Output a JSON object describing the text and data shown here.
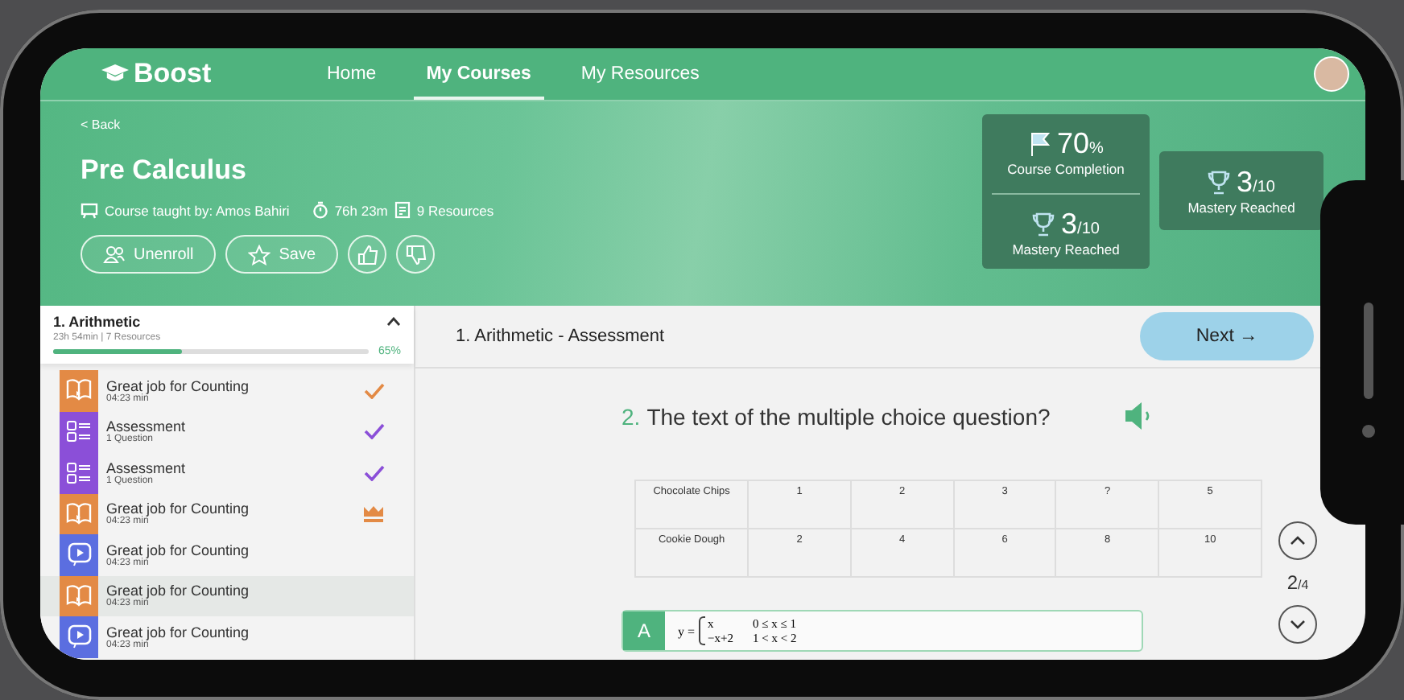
{
  "nav": {
    "logo": "Boost",
    "items": [
      {
        "label": "Home",
        "selected": false
      },
      {
        "label": "My Courses",
        "selected": true
      },
      {
        "label": "My Resources",
        "selected": false
      }
    ]
  },
  "course": {
    "back": "< Back",
    "title": "Pre Calculus",
    "teacher": "Course taught by: Amos Bahiri",
    "duration": "76h 23m",
    "resources": "9 Resources",
    "buttons": [
      {
        "kind": "unenroll",
        "label": "Unenroll"
      },
      {
        "kind": "save",
        "label": "Save"
      },
      {
        "kind": "like"
      },
      {
        "kind": "dislike"
      }
    ]
  },
  "stats": {
    "completion": {
      "value": "70$_{%}$",
      "label": "Course Completion"
    },
    "mastery": {
      "value": "3$_{/10}$",
      "label": "Mastery Reached"
    },
    "mastery_card": {
      "value": "3$_{/10}$",
      "label": "Mastery Reached"
    }
  },
  "sidebar": {
    "title": "1. Arithmetic",
    "meta": "23h 54min | 7 Resources",
    "level": 0.41,
    "percent": "65%",
    "expanded": true,
    "items": [
      {
        "kind": "reading",
        "title": "Great job for Counting",
        "subtitle": "04:23 min",
        "completed": true,
        "mastered": false,
        "selected": false
      },
      {
        "kind": "assessment",
        "title": "Assessment",
        "subtitle": "1 Question",
        "completed": true,
        "mastered": false,
        "selected": false
      },
      {
        "kind": "assessment",
        "title": "Assessment",
        "subtitle": "1 Question",
        "completed": true,
        "mastered": false,
        "selected": false
      },
      {
        "kind": "reading",
        "title": "Great job for Counting",
        "subtitle": "04:23 min",
        "completed": false,
        "mastered": true,
        "selected": false
      },
      {
        "kind": "video",
        "title": "Great job for Counting",
        "subtitle": "04:23 min",
        "completed": false,
        "mastered": false,
        "selected": false
      },
      {
        "kind": "reading",
        "title": "Great job for Counting",
        "subtitle": "04:23 min",
        "completed": false,
        "mastered": false,
        "selected": true
      },
      {
        "kind": "video",
        "title": "Great job for Counting",
        "subtitle": "04:23 min",
        "completed": false,
        "mastered": false,
        "selected": false
      }
    ]
  },
  "main": {
    "title": "1. Arithmetic - Assessment",
    "next": "Next →",
    "question_number": "2.",
    "question": "The text of the multiple choice question?",
    "table": [
      [
        "Chocolate Chips",
        "1",
        "2",
        "3",
        "?",
        "5"
      ],
      [
        "Cookie Dough",
        "2",
        "4",
        "6",
        "8",
        "10"
      ]
    ],
    "answers": [
      {
        "letter": "A",
        "lhs": "y =",
        "lines": [
          [
            "x",
            "0 ≤ x ≤ 1"
          ],
          [
            "−x+2",
            "1 < x < 2"
          ]
        ]
      }
    ],
    "pager": "2$_{/4}$"
  }
}
